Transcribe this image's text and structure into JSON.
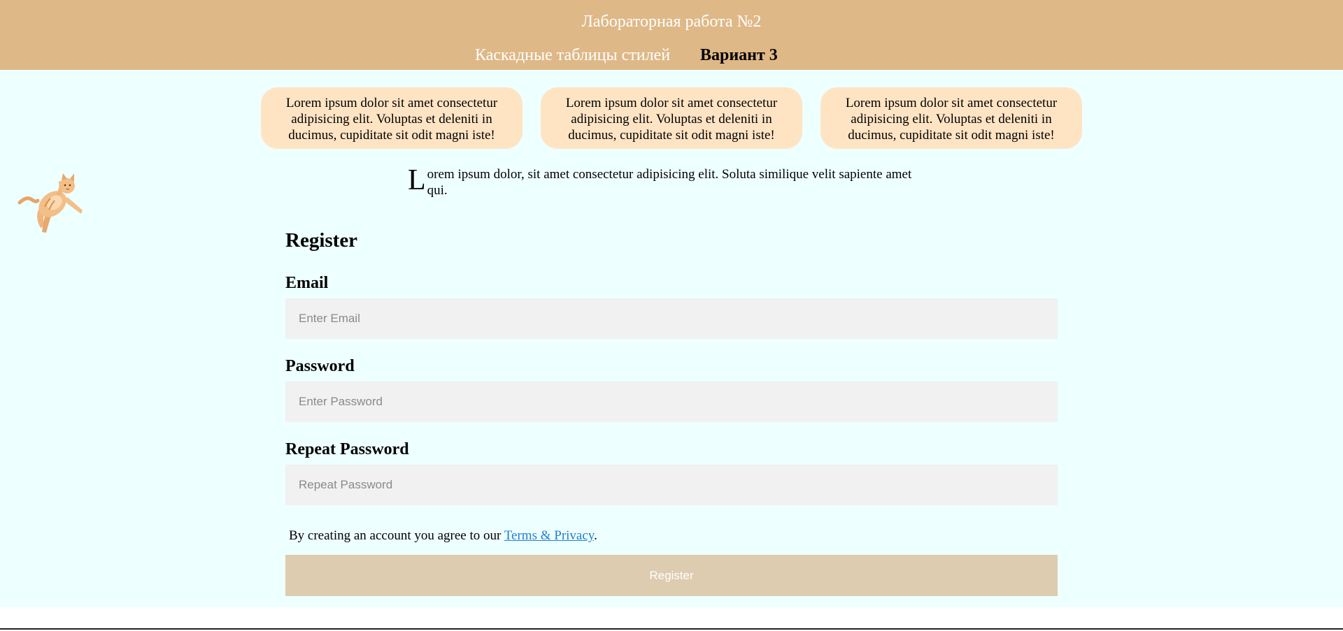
{
  "header": {
    "title": "Лабораторная работа №2",
    "subtitle": "Каскадные таблицы стилей",
    "variant": "Вариант 3",
    "background": "#DFB887"
  },
  "cards": [
    {
      "text": "Lorem ipsum dolor sit amet consectetur adipisicing elit. Voluptas et deleniti in ducimus, cupiditate sit odit magni iste!"
    },
    {
      "text": "Lorem ipsum dolor sit amet consectetur adipisicing elit. Voluptas et deleniti in ducimus, cupiditate sit odit magni iste!"
    },
    {
      "text": "Lorem ipsum dolor sit amet consectetur adipisicing elit. Voluptas et deleniti in ducimus, cupiditate sit odit magni iste!"
    }
  ],
  "intro": {
    "drop_letter": "L",
    "rest": "orem ipsum dolor, sit amet consectetur adipisicing elit. Soluta similique velit sapiente amet qui."
  },
  "form": {
    "title": "Register",
    "email_label": "Email",
    "email_placeholder": "Enter Email",
    "password_label": "Password",
    "password_placeholder": "Enter Password",
    "repeat_label": "Repeat Password",
    "repeat_placeholder": "Repeat Password",
    "terms_prefix": "By creating an account you agree to our ",
    "terms_link": "Terms & Privacy",
    "terms_suffix": ".",
    "register_button": "Register"
  },
  "colors": {
    "page_bg": "#EEFFFF",
    "card_bg": "#FFE4C4",
    "input_bg": "#F1F1F1",
    "button_bg": "#DDCCAF",
    "link": "#1E7FD0"
  },
  "icons": {
    "cat_image": "cat-illustration"
  }
}
